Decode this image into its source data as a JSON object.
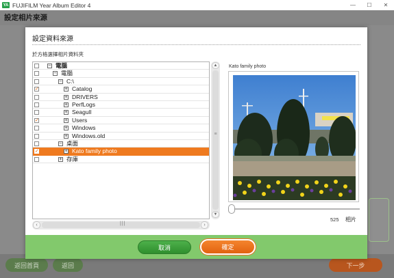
{
  "app": {
    "title": "FUJIFILM Year Album Editor 4",
    "icon_text": "YA"
  },
  "window_controls": {
    "minimize": "—",
    "maximize": "☐",
    "close": "✕"
  },
  "background": {
    "page_title": "設定相片來源",
    "back_to_home_label": "返回首頁",
    "back_label": "返回",
    "next_label": "下一步"
  },
  "dialog": {
    "title": "設定資料來源",
    "subtitle": "於方格選擇相片資料夾",
    "tree": [
      {
        "label": "電腦",
        "checked": false,
        "expander": "−",
        "bold": true,
        "selected": false
      },
      {
        "label": "電腦",
        "checked": false,
        "expander": "−",
        "bold": false,
        "selected": false
      },
      {
        "label": "C:\\",
        "checked": false,
        "expander": "−",
        "bold": false,
        "selected": false
      },
      {
        "label": "Catalog",
        "checked": true,
        "expander": "+",
        "bold": false,
        "selected": false
      },
      {
        "label": "DRIVERS",
        "checked": false,
        "expander": "+",
        "bold": false,
        "selected": false
      },
      {
        "label": "PerfLogs",
        "checked": false,
        "expander": "+",
        "bold": false,
        "selected": false
      },
      {
        "label": "Seagull",
        "checked": false,
        "expander": "+",
        "bold": false,
        "selected": false
      },
      {
        "label": "Users",
        "checked": true,
        "expander": "+",
        "bold": false,
        "selected": false
      },
      {
        "label": "Windows",
        "checked": false,
        "expander": "+",
        "bold": false,
        "selected": false
      },
      {
        "label": "Windows.old",
        "checked": false,
        "expander": "+",
        "bold": false,
        "selected": false
      },
      {
        "label": "桌面",
        "checked": false,
        "expander": "−",
        "bold": false,
        "selected": false
      },
      {
        "label": "Kato family photo",
        "checked": true,
        "expander": "+",
        "bold": false,
        "selected": true
      },
      {
        "label": "存庫",
        "checked": false,
        "expander": "+",
        "bold": false,
        "selected": false
      }
    ],
    "preview_title": "Kato family photo",
    "photo_count": "525",
    "photo_count_unit": "相片",
    "cancel_label": "取消",
    "ok_label": "確定"
  },
  "scrollbar": {
    "up": "▲",
    "down": "▼",
    "left": "‹",
    "right": "›",
    "v_grip": "≡",
    "h_grip": "|||"
  },
  "colors": {
    "accent_orange": "#ef7a1f",
    "footer_green": "#82c96c",
    "cancel_green": "#3aa338",
    "check_orange": "#e06a10"
  }
}
